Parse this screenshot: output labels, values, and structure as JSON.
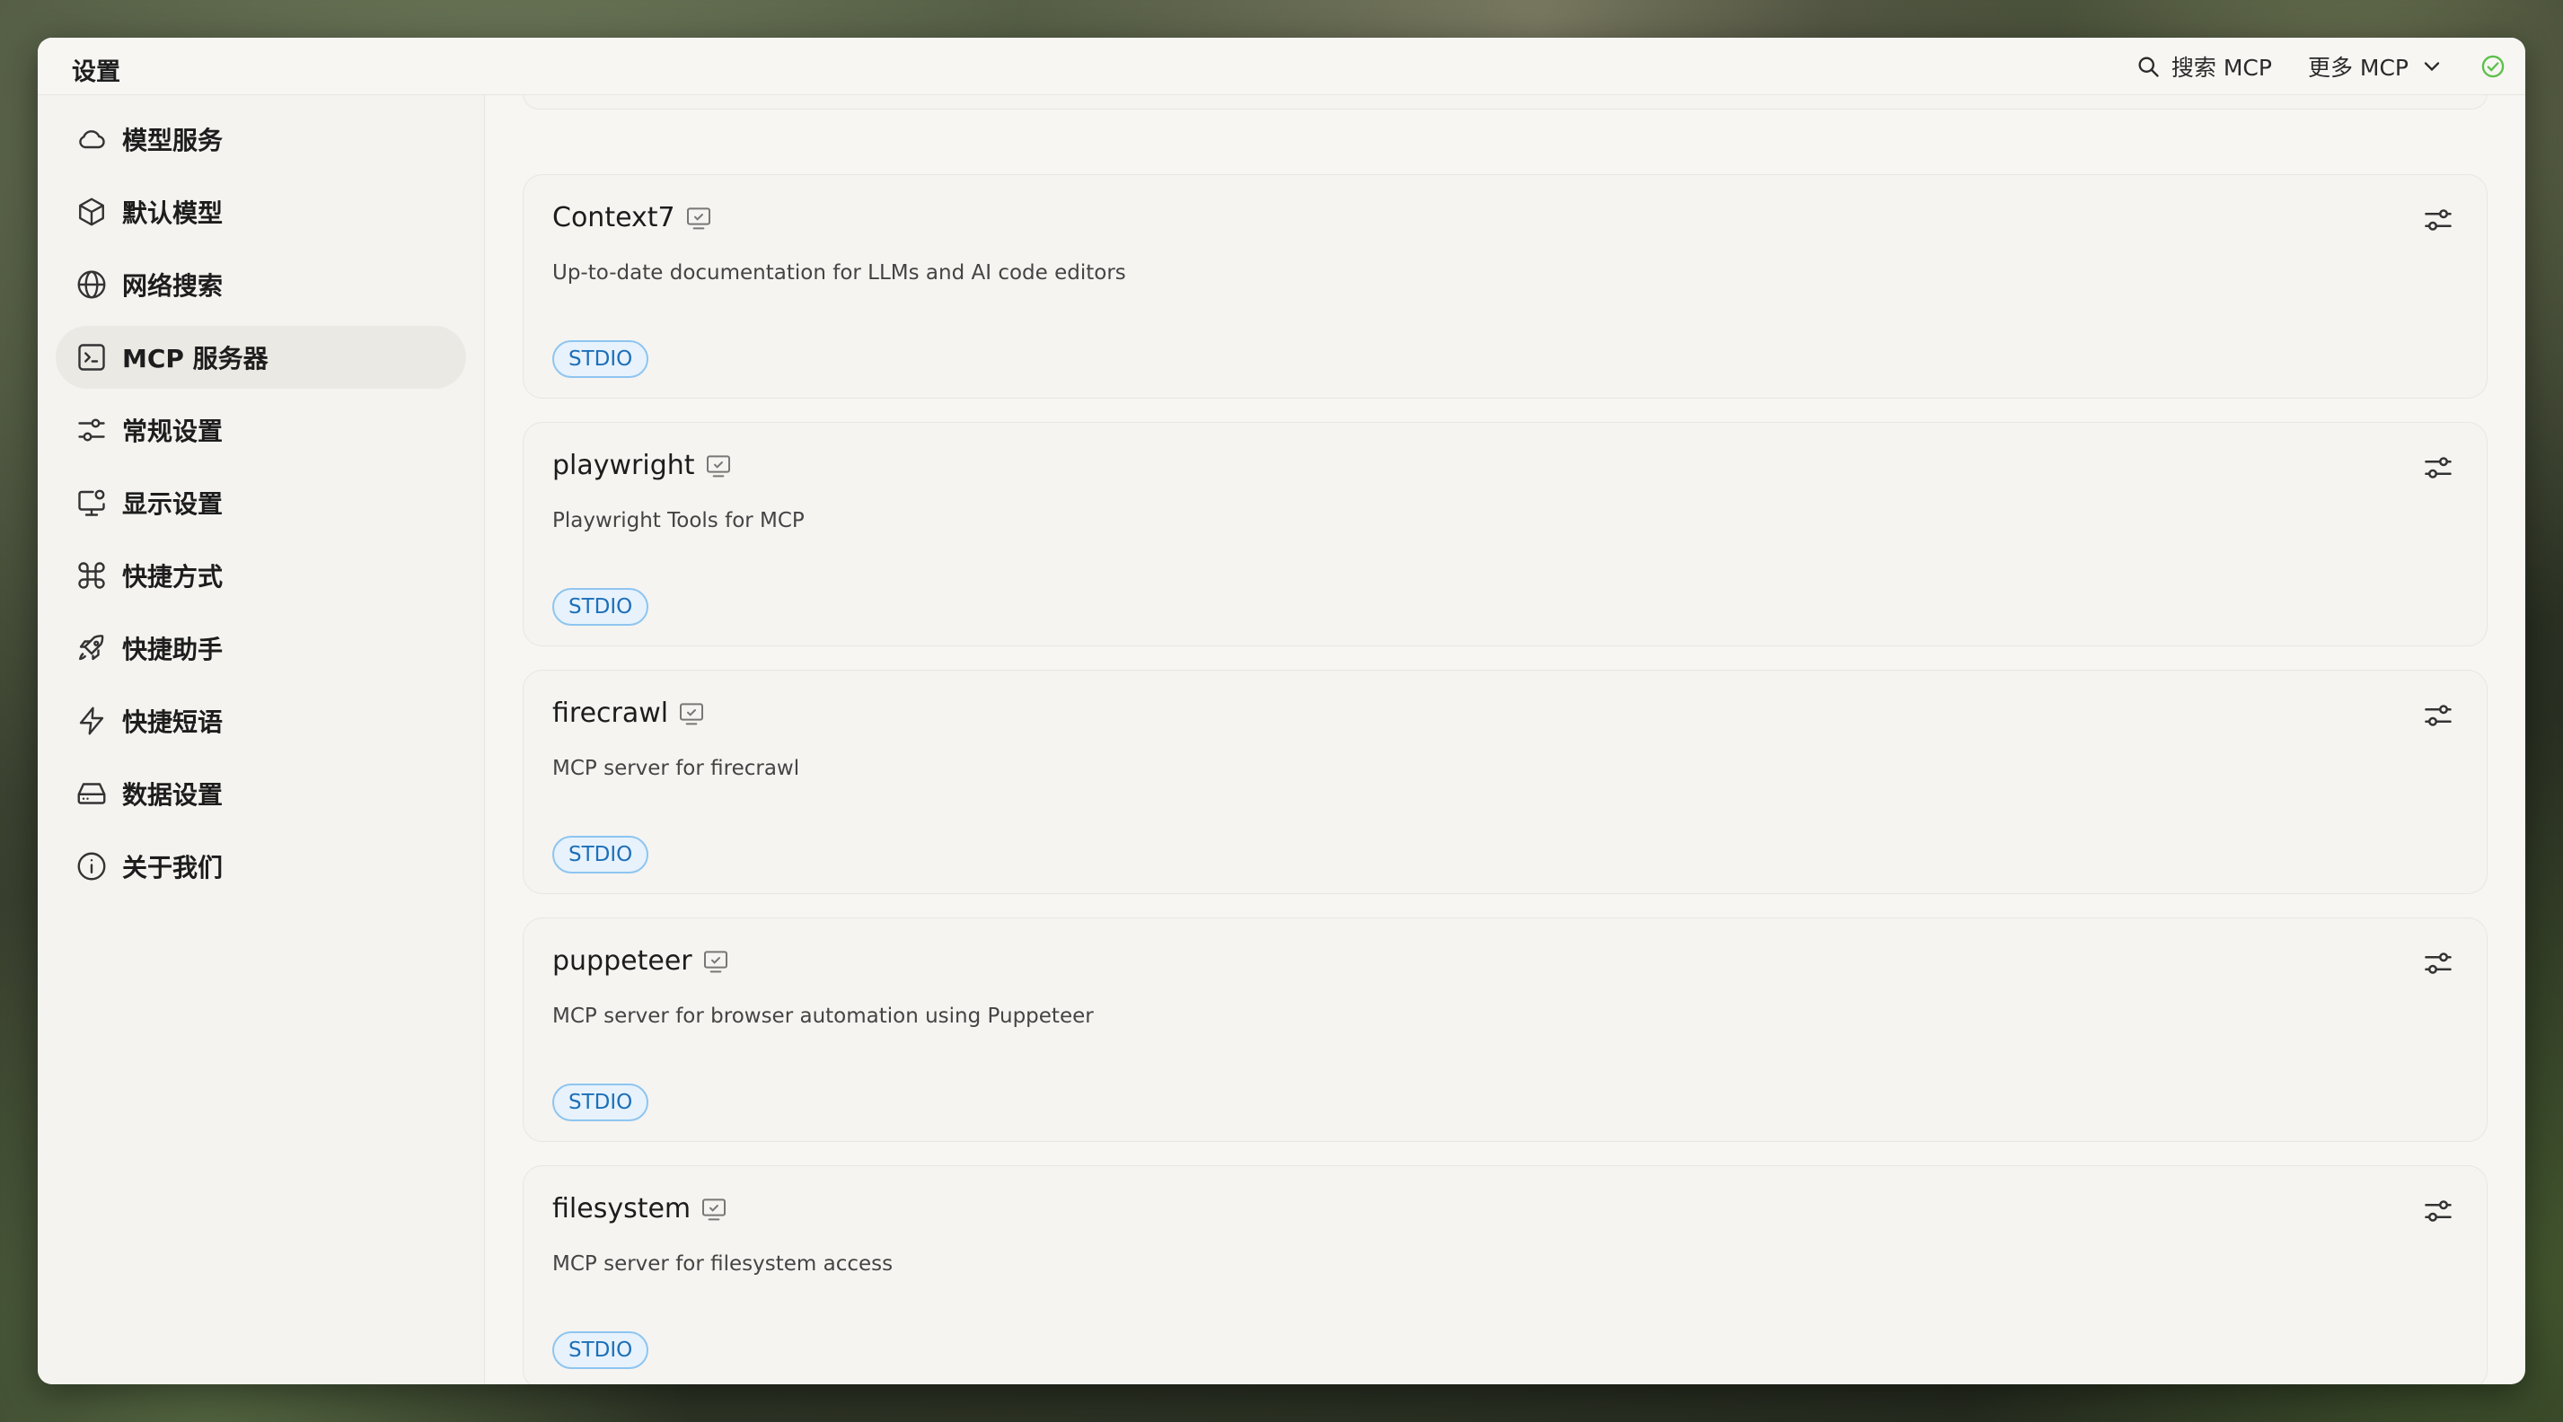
{
  "window": {
    "title": "设置"
  },
  "toolbar": {
    "search_label": "搜索 MCP",
    "more_label": "更多 MCP",
    "status_color": "#5cc04a"
  },
  "sidebar": {
    "items": [
      {
        "label": "模型服务",
        "icon": "cloud-icon",
        "active": false
      },
      {
        "label": "默认模型",
        "icon": "cube-icon",
        "active": false
      },
      {
        "label": "网络搜索",
        "icon": "globe-icon",
        "active": false
      },
      {
        "label": "MCP 服务器",
        "icon": "terminal-icon",
        "active": true
      },
      {
        "label": "常规设置",
        "icon": "sliders-icon",
        "active": false
      },
      {
        "label": "显示设置",
        "icon": "monitor-settings-icon",
        "active": false
      },
      {
        "label": "快捷方式",
        "icon": "command-icon",
        "active": false
      },
      {
        "label": "快捷助手",
        "icon": "rocket-icon",
        "active": false
      },
      {
        "label": "快捷短语",
        "icon": "zap-icon",
        "active": false
      },
      {
        "label": "数据设置",
        "icon": "hard-drive-icon",
        "active": false
      },
      {
        "label": "关于我们",
        "icon": "info-icon",
        "active": false
      }
    ]
  },
  "servers": [
    {
      "name": "Context7",
      "description": "Up-to-date documentation for LLMs and AI code editors",
      "tag": "STDIO"
    },
    {
      "name": "playwright",
      "description": "Playwright Tools for MCP",
      "tag": "STDIO"
    },
    {
      "name": "firecrawl",
      "description": "MCP server for firecrawl",
      "tag": "STDIO"
    },
    {
      "name": "puppeteer",
      "description": "MCP server for browser automation using Puppeteer",
      "tag": "STDIO"
    },
    {
      "name": "filesystem",
      "description": "MCP server for filesystem access",
      "tag": "STDIO"
    }
  ],
  "colors": {
    "tag_text": "#1c6fb8",
    "tag_border": "#8ec5f0",
    "tag_bg": "#e7f2fc"
  }
}
